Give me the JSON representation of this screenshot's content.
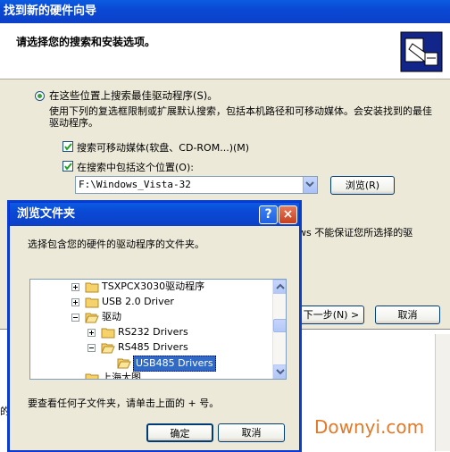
{
  "wizard": {
    "title": "找到新的硬件向导",
    "header_title": "请选择您的搜索和安装选项。",
    "radio_search_label": "在这些位置上搜索最佳驱动程序(S)。",
    "description": "使用下列的复选框限制或扩展默认搜索，包括本机路径和可移动媒体。会安装找到的最佳驱动程序。",
    "chk_removable_label": "搜索可移动媒体(软盘、CD-ROM...)(M)",
    "chk_include_label": "在搜索中包括这个位置(O):",
    "path_value": "F:\\Windows_Vista-32",
    "browse_button": "浏览(R)",
    "fragment_right": "ws 不能保证您所选择的驱",
    "next_button": "下一步(N) >",
    "cancel_button": "取消",
    "fragment_bottom": "的"
  },
  "dialog": {
    "title": "浏览文件夹",
    "help_glyph": "?",
    "close_glyph": "×",
    "instruction": "选择包含您的硬件的驱动程序的文件夹。",
    "tree": [
      {
        "label": "TSXPCX3030驱动程序",
        "expander": "+"
      },
      {
        "label": "USB 2.0 Driver",
        "expander": "+"
      },
      {
        "label": "驱动",
        "expander": "-"
      },
      {
        "label": "RS232 Drivers",
        "expander": "+"
      },
      {
        "label": "RS485 Drivers",
        "expander": "-"
      },
      {
        "label": "USB485 Drivers",
        "expander": ""
      },
      {
        "label": "上海大图",
        "expander": ""
      }
    ],
    "hint": "要查看任何子文件夹，请单击上面的 + 号。",
    "ok_button": "确定",
    "cancel_button": "取消"
  },
  "watermark": "Downyi.com",
  "colors": {
    "titlebar": "#0a49d4",
    "selection": "#316ac5",
    "watermark": "#e07a2a"
  }
}
